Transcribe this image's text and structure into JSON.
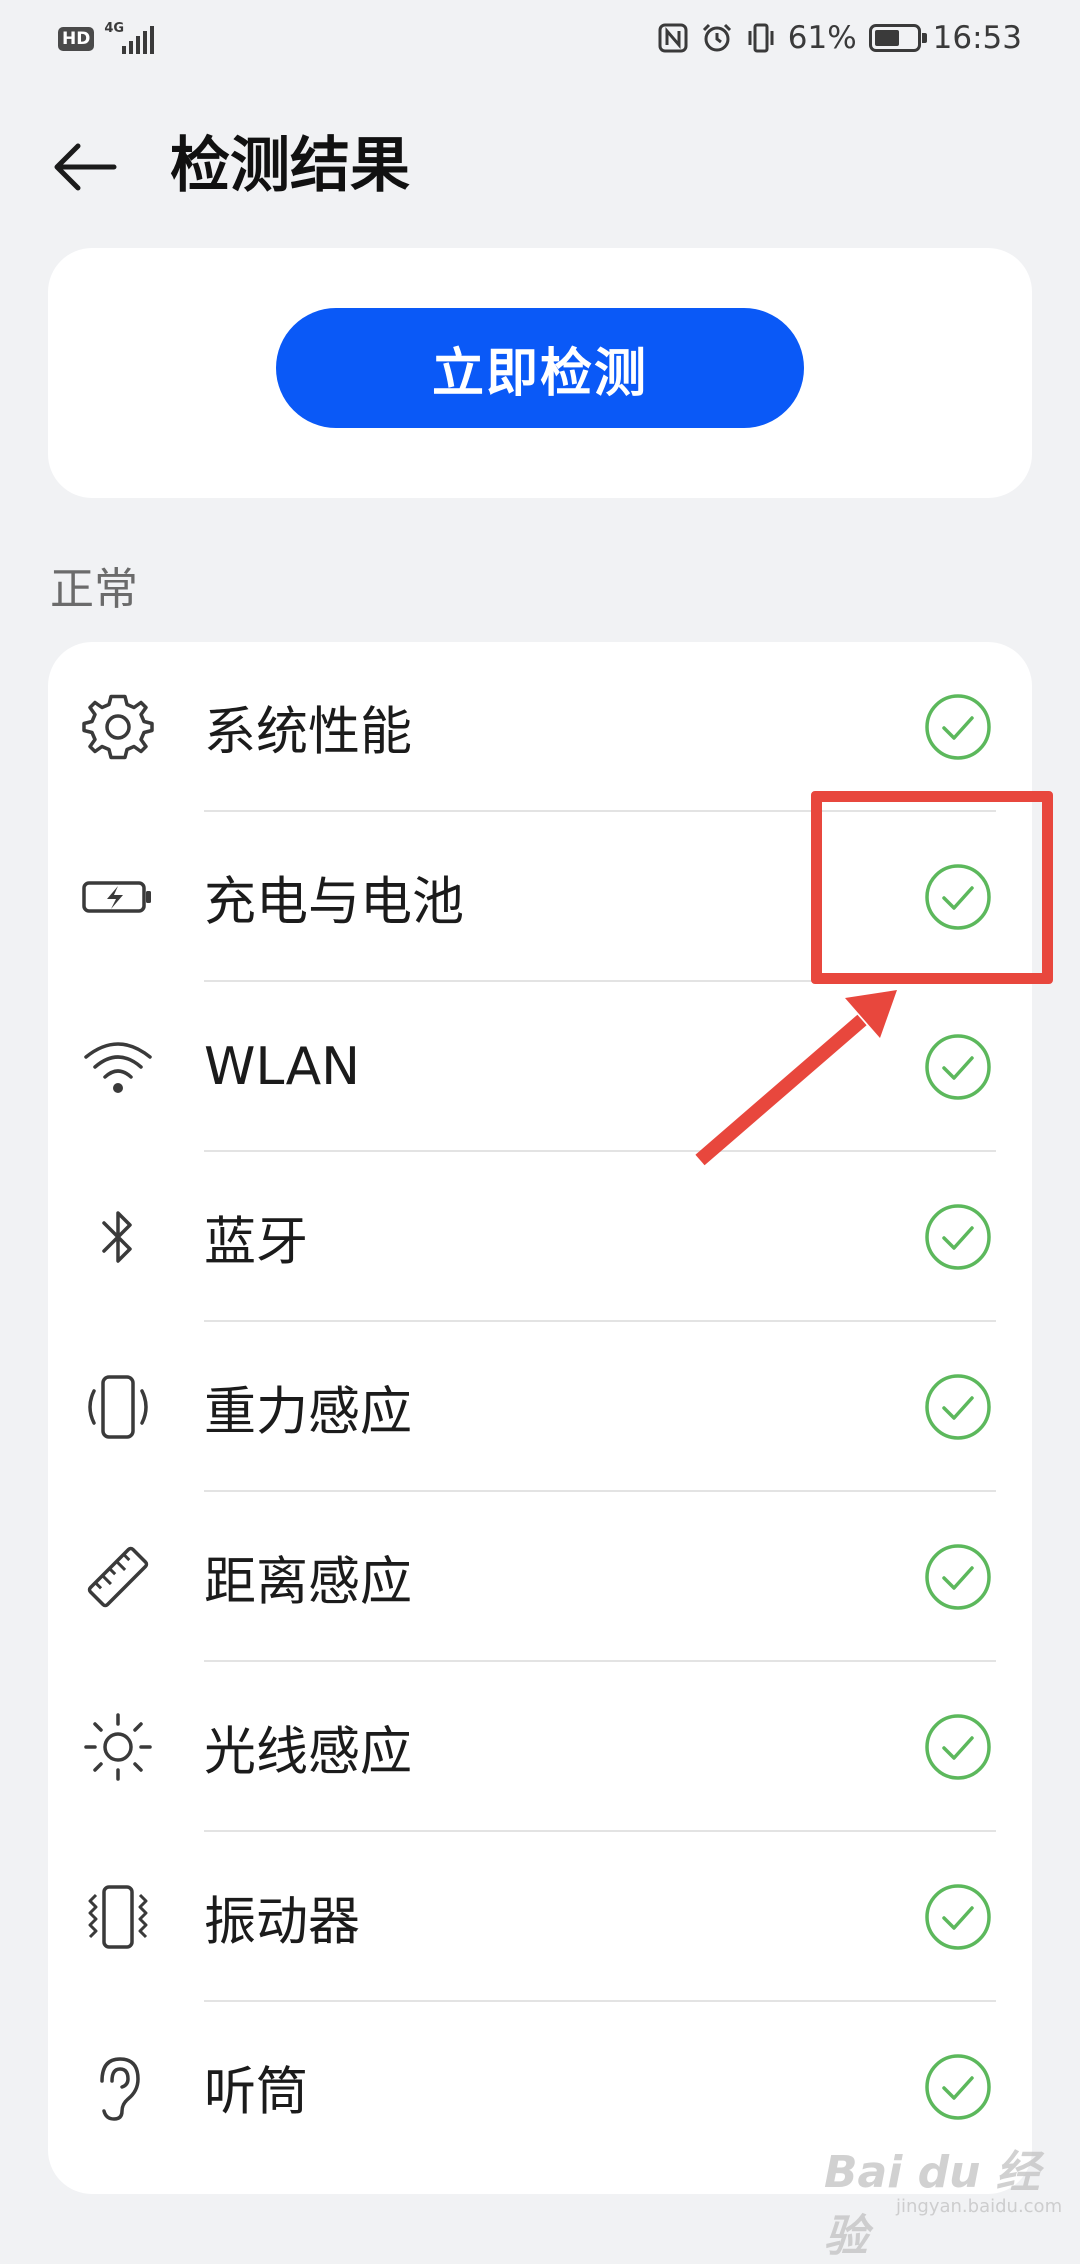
{
  "status_bar": {
    "hd": "HD",
    "network": "4G",
    "battery_percent": "61%",
    "battery_level": 0.61,
    "time": "16:53",
    "icons": [
      "nfc-icon",
      "alarm-icon",
      "vibrate-icon",
      "battery-icon"
    ]
  },
  "header": {
    "title": "检测结果"
  },
  "detect_button_label": "立即检测",
  "section_label": "正常",
  "items": [
    {
      "label": "系统性能",
      "icon": "gear-icon",
      "status": "ok"
    },
    {
      "label": "充电与电池",
      "icon": "battery-charge-icon",
      "status": "ok"
    },
    {
      "label": "WLAN",
      "icon": "wifi-icon",
      "status": "ok"
    },
    {
      "label": "蓝牙",
      "icon": "bluetooth-icon",
      "status": "ok"
    },
    {
      "label": "重力感应",
      "icon": "rotate-phone-icon",
      "status": "ok"
    },
    {
      "label": "距离感应",
      "icon": "ruler-icon",
      "status": "ok"
    },
    {
      "label": "光线感应",
      "icon": "sun-icon",
      "status": "ok"
    },
    {
      "label": "振动器",
      "icon": "vibrate-phone-icon",
      "status": "ok"
    },
    {
      "label": "听筒",
      "icon": "ear-icon",
      "status": "ok"
    }
  ],
  "colors": {
    "accent": "#0a59f7",
    "check": "#5cb85c",
    "annotation": "#e8473d"
  },
  "watermark": "Bai du 经验",
  "watermark_sub": "jingyan.baidu.com"
}
